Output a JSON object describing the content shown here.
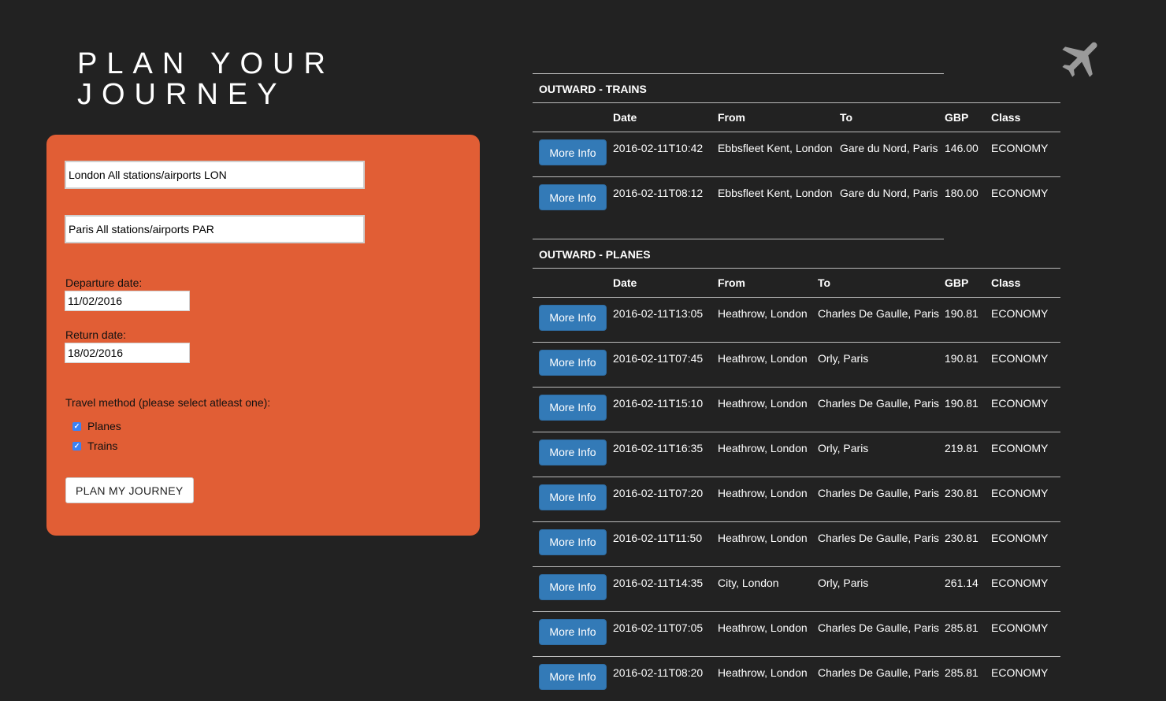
{
  "page": {
    "title": "PLAN YOUR\nJOURNEY"
  },
  "form": {
    "from_value": "London All stations/airports LON",
    "to_value": "Paris All stations/airports PAR",
    "departure_label": "Departure date:",
    "departure_value": "11/02/2016",
    "return_label": "Return date:",
    "return_value": "18/02/2016",
    "method_label": "Travel method (please select atleast one):",
    "planes_label": "Planes",
    "planes_checked": true,
    "trains_label": "Trains",
    "trains_checked": true,
    "submit_label": "PLAN MY JOURNEY"
  },
  "icons": {
    "top_right": "airplane-icon"
  },
  "colors": {
    "panel": "#e15e35",
    "background": "#222222",
    "button": "#337ab7"
  },
  "trains": {
    "heading": "OUTWARD - TRAINS",
    "columns": [
      "",
      "Date",
      "From",
      "To",
      "GBP",
      "Class"
    ],
    "button_label": "More Info",
    "rows": [
      {
        "date": "2016-02-11T10:42",
        "from": "Ebbsfleet Kent, London",
        "to": "Gare du Nord, Paris",
        "gbp": "146.00",
        "class": "ECONOMY"
      },
      {
        "date": "2016-02-11T08:12",
        "from": "Ebbsfleet Kent, London",
        "to": "Gare du Nord, Paris",
        "gbp": "180.00",
        "class": "ECONOMY"
      }
    ]
  },
  "planes": {
    "heading": "OUTWARD - PLANES",
    "columns": [
      "",
      "Date",
      "From",
      "To",
      "GBP",
      "Class"
    ],
    "button_label": "More Info",
    "rows": [
      {
        "date": "2016-02-11T13:05",
        "from": "Heathrow, London",
        "to": "Charles De Gaulle, Paris",
        "gbp": "190.81",
        "class": "ECONOMY"
      },
      {
        "date": "2016-02-11T07:45",
        "from": "Heathrow, London",
        "to": "Orly, Paris",
        "gbp": "190.81",
        "class": "ECONOMY"
      },
      {
        "date": "2016-02-11T15:10",
        "from": "Heathrow, London",
        "to": "Charles De Gaulle, Paris",
        "gbp": "190.81",
        "class": "ECONOMY"
      },
      {
        "date": "2016-02-11T16:35",
        "from": "Heathrow, London",
        "to": "Orly, Paris",
        "gbp": "219.81",
        "class": "ECONOMY"
      },
      {
        "date": "2016-02-11T07:20",
        "from": "Heathrow, London",
        "to": "Charles De Gaulle, Paris",
        "gbp": "230.81",
        "class": "ECONOMY"
      },
      {
        "date": "2016-02-11T11:50",
        "from": "Heathrow, London",
        "to": "Charles De Gaulle, Paris",
        "gbp": "230.81",
        "class": "ECONOMY"
      },
      {
        "date": "2016-02-11T14:35",
        "from": "City, London",
        "to": "Orly, Paris",
        "gbp": "261.14",
        "class": "ECONOMY"
      },
      {
        "date": "2016-02-11T07:05",
        "from": "Heathrow, London",
        "to": "Charles De Gaulle, Paris",
        "gbp": "285.81",
        "class": "ECONOMY"
      },
      {
        "date": "2016-02-11T08:20",
        "from": "Heathrow, London",
        "to": "Charles De Gaulle, Paris",
        "gbp": "285.81",
        "class": "ECONOMY"
      }
    ]
  }
}
